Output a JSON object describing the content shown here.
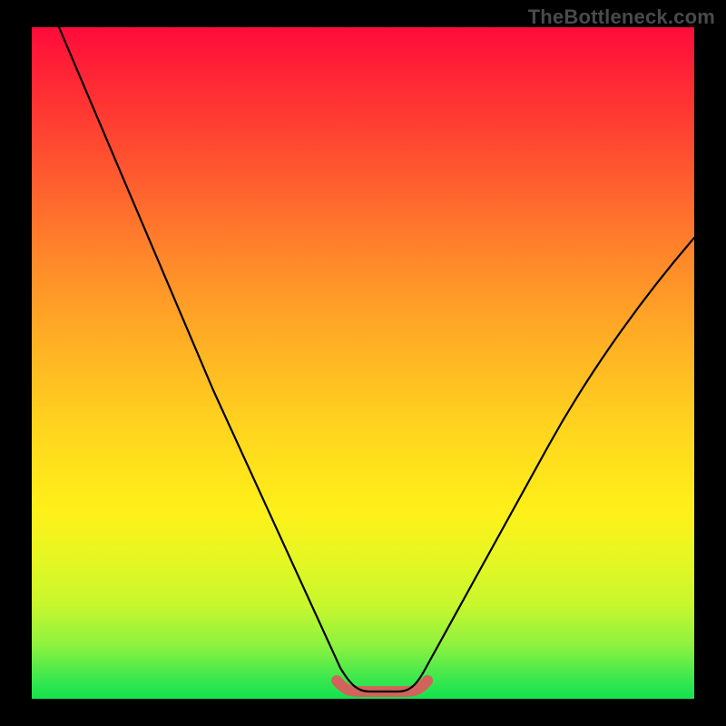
{
  "watermark": "TheBottleneck.com",
  "colors": {
    "background": "#000000",
    "curve": "#000000",
    "valley_highlight": "#d2635c",
    "gradient_top": "#ff0b3b",
    "gradient_bottom": "#13e24d"
  },
  "chart_data": {
    "type": "line",
    "title": "",
    "xlabel": "",
    "ylabel": "",
    "xlim": [
      0,
      100
    ],
    "ylim": [
      0,
      100
    ],
    "x": [
      0,
      5,
      10,
      15,
      20,
      25,
      30,
      35,
      40,
      45,
      48,
      50,
      52,
      55,
      58,
      60,
      65,
      70,
      75,
      80,
      85,
      90,
      95,
      100
    ],
    "values": [
      100,
      91,
      82,
      72,
      63,
      54,
      45,
      36,
      26,
      14,
      4,
      1,
      1,
      1,
      4,
      9,
      18,
      27,
      35,
      42,
      49,
      56,
      62,
      68
    ],
    "series": [
      {
        "name": "bottleneck-curve",
        "x": [
          0,
          5,
          10,
          15,
          20,
          25,
          30,
          35,
          40,
          45,
          48,
          50,
          52,
          55,
          58,
          60,
          65,
          70,
          75,
          80,
          85,
          90,
          95,
          100
        ],
        "values": [
          100,
          91,
          82,
          72,
          63,
          54,
          45,
          36,
          26,
          14,
          4,
          1,
          1,
          1,
          4,
          9,
          18,
          27,
          35,
          42,
          49,
          56,
          62,
          68
        ]
      }
    ],
    "annotations": [
      {
        "name": "valley-highlight",
        "x_range": [
          47,
          59
        ],
        "y": 1,
        "color": "#d2635c"
      }
    ],
    "legend": false,
    "grid": false
  }
}
